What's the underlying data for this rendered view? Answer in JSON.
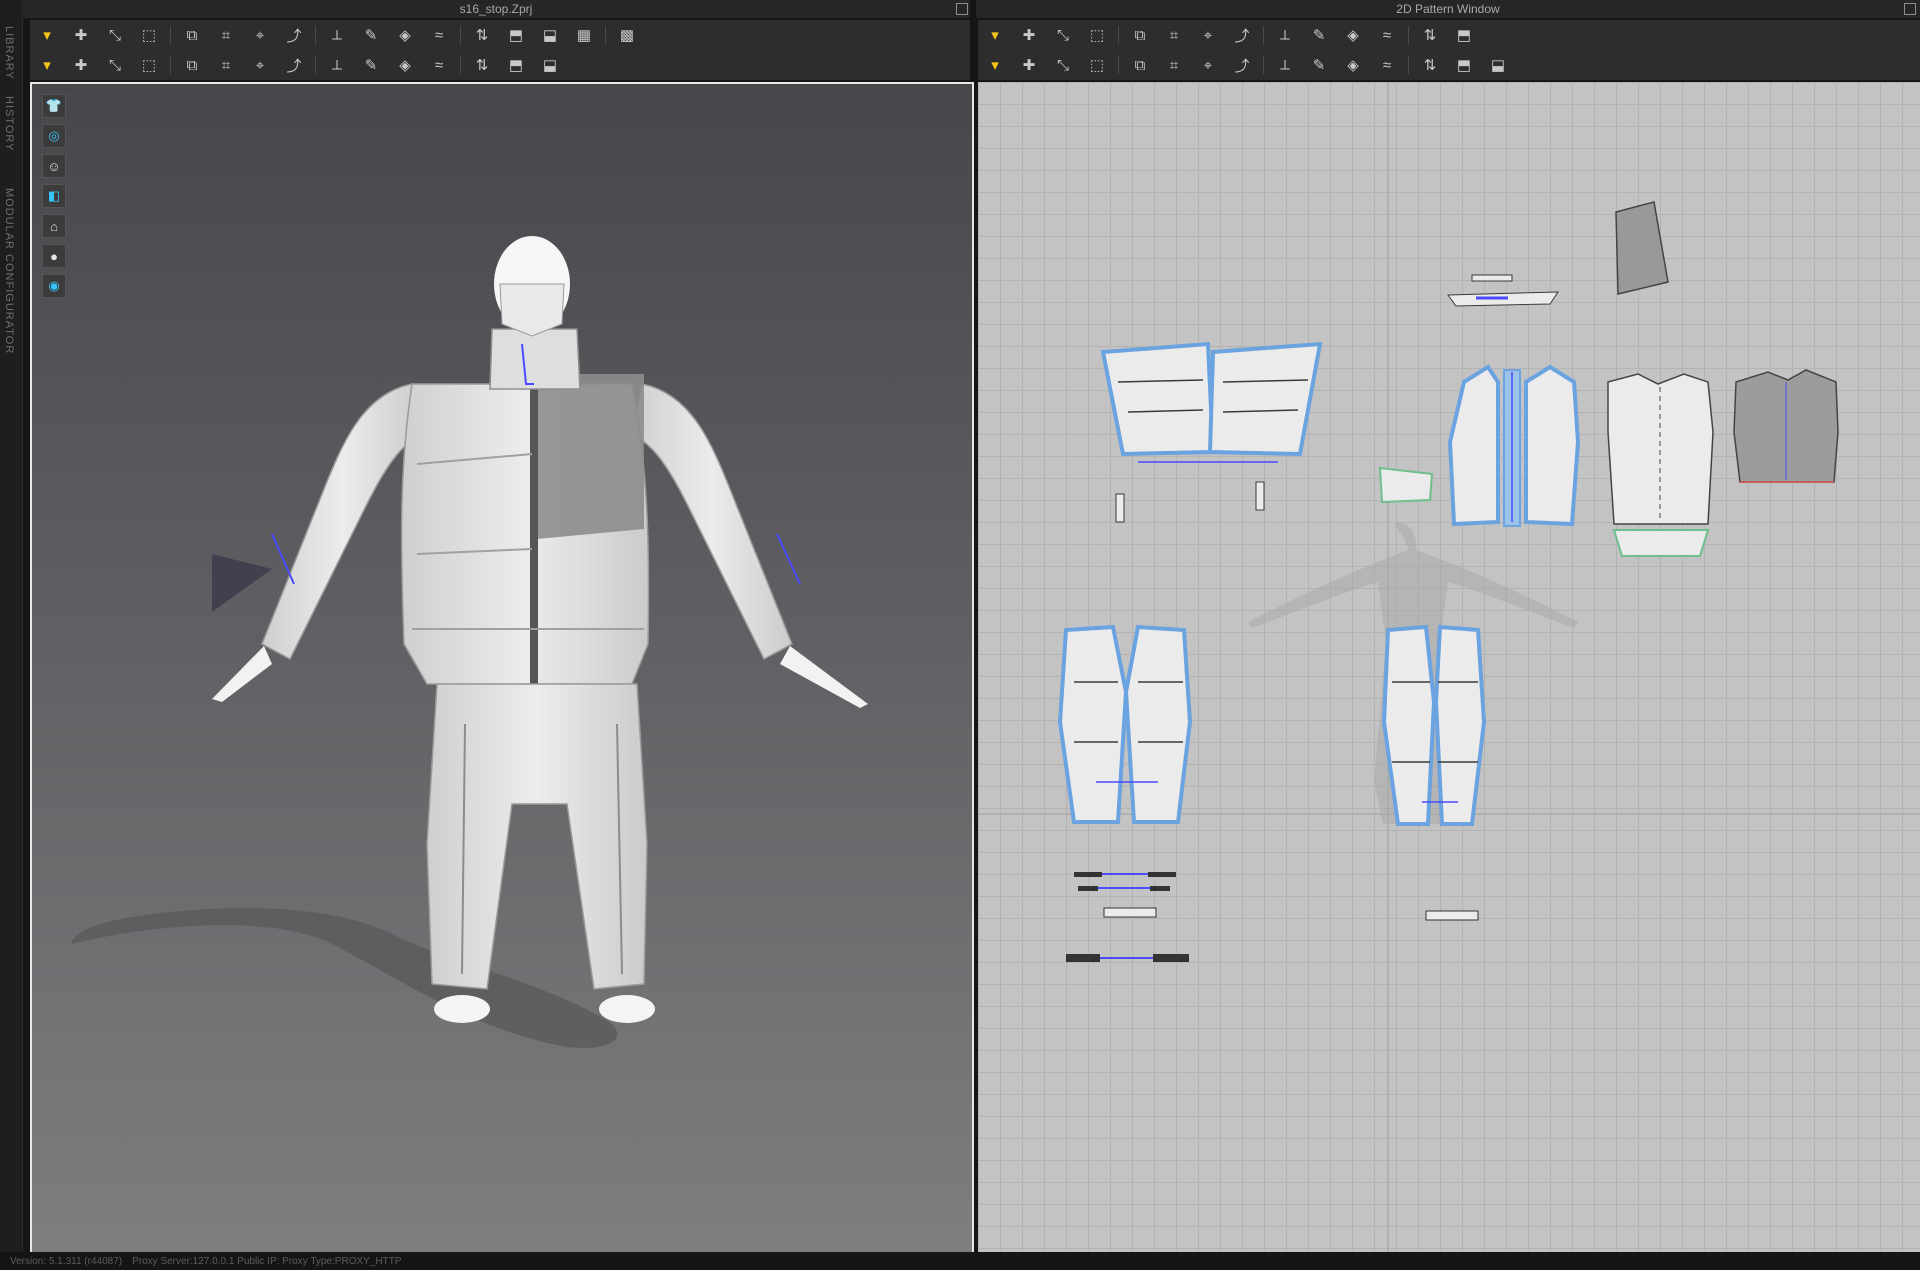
{
  "left_sidebar": {
    "tabs": [
      "LIBRARY",
      "HISTORY",
      "MODULAR CONFIGURATOR"
    ]
  },
  "panel_3d": {
    "title": "s16_stop.Zprj",
    "toolbar_row1_icons": [
      "select-move-icon",
      "add-point-icon",
      "edit-curve-icon",
      "transform-icon",
      "pin-icon",
      "tack-icon",
      "tack-on-avatar-icon",
      "fold-icon",
      "measure-icon",
      "brush-icon",
      "shape-icon",
      "smooth-icon",
      "arrangement-icon",
      "garment-icon",
      "avatar-icon",
      "grid-icon",
      "wide-grid-icon"
    ],
    "toolbar_row2_icons": [
      "avatar-pose-icon",
      "fabric-icon",
      "steam-icon",
      "stitch-icon",
      "zip-icon",
      "puckering-icon",
      "tape-icon",
      "button-icon",
      "snap-icon",
      "line-icon",
      "toggle-icon",
      "hanger-icon",
      "measure-tape-icon",
      "ruler-icon",
      "center-icon"
    ],
    "viewport_tools": [
      {
        "icon": "garment-visibility-icon",
        "active": false
      },
      {
        "icon": "texture-view-icon",
        "active": true
      },
      {
        "icon": "avatar-display-icon",
        "active": false
      },
      {
        "icon": "fabric-display-icon",
        "active": true
      },
      {
        "icon": "hanger-view-icon",
        "active": false
      },
      {
        "icon": "avatar-silhouette-icon",
        "active": false
      },
      {
        "icon": "environment-sphere-icon",
        "active": true
      }
    ]
  },
  "panel_2d": {
    "title": "2D Pattern Window",
    "toolbar_row1_icons": [
      "transform-pattern-icon",
      "edit-pattern-icon",
      "edit-curve-point-icon",
      "curvature-icon",
      "add-point-icon",
      "polygon-icon",
      "rectangle-icon",
      "ellipse-icon",
      "internal-polygon-icon",
      "dart-icon",
      "trace-icon",
      "notch-icon",
      "seam-allowance-icon",
      "grid-icon"
    ],
    "toolbar_row2_icons": [
      "segment-sewing-icon",
      "free-sewing-icon",
      "multi-sewing-icon",
      "check-sewing-icon",
      "edit-sewing-icon",
      "iron-icon",
      "fold-arrangement-icon",
      "tack-icon",
      "pleat-icon",
      "puckering-icon",
      "zipper-icon",
      "measure-icon",
      "line-length-icon",
      "curve-measure-icon",
      "tape-icon"
    ]
  },
  "status": {
    "version": "Version: 5.1.311 (r44087)",
    "proxy": "Proxy Server:127.0.0.1  Public IP:  Proxy Type:PROXY_HTTP"
  },
  "colors": {
    "accent_yellow": "#f5c518",
    "selected_outline": "#6aa3e0",
    "stitch_blue": "#4b4bff",
    "seam_green": "#6fbf8a",
    "app_bg": "#151515",
    "toolbar_bg": "#2d2d2d",
    "pattern_bg": "#c3c3c3"
  }
}
